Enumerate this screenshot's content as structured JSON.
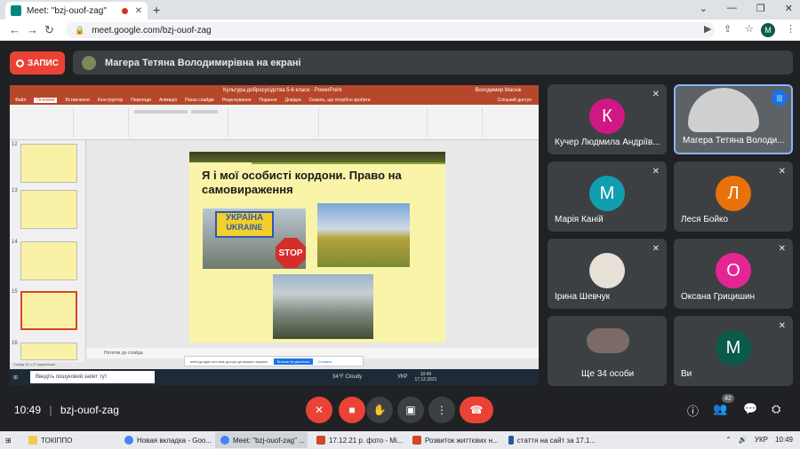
{
  "browser": {
    "tab_title": "Meet: \"bzj-ouof-zag\"",
    "url": "meet.google.com/bzj-ouof-zag",
    "profile_initial": "M"
  },
  "meet": {
    "record_label": "ЗАПИС",
    "presenting_text": "Магера Тетяна Володимирівна на екрані",
    "meeting_code": "bzj-ouof-zag",
    "time": "10:49",
    "participants_count": "42"
  },
  "ppt": {
    "window_title": "Культура добросусідства 5-6 класи - PowerPoint",
    "user": "Володимир Маснік",
    "menu": [
      "Файл",
      "Основне",
      "Вставлення",
      "Конструктор",
      "Переходи",
      "Анімація",
      "Показ слайдів",
      "Рецензування",
      "Подання",
      "Довідка",
      "Скажіть, що потрібно зробити",
      "Спільний доступ"
    ],
    "slide_title": "Я і мої особисті кордони. Право на самовираження",
    "sign_top": "УКРАЇНА",
    "sign_bottom": "UKRAINE",
    "stop": "STOP",
    "notes": "Нотатки до слайда",
    "share_text": "meet.google.com має доступ до вашого екрана.",
    "share_stop": "Більше не ділитися",
    "share_hide": "Сховати",
    "status": "Слайд 15 з 27   українська",
    "win_search": "Введіть пошуковий запит тут",
    "weather": "34°F Cloudy",
    "lang": "УКР",
    "win_time": "10:49",
    "win_date": "17.12.2021",
    "thumb_numbers": [
      "12",
      "13",
      "14",
      "15",
      "16"
    ]
  },
  "tiles": [
    {
      "initial": "К",
      "name": "Кучер Людмила Андріїв...",
      "color": "#d01884"
    },
    {
      "initial": "",
      "name": "Магера Тетяна Володи...",
      "color": "#cfcfcf"
    },
    {
      "initial": "М",
      "name": "Марія Каній",
      "color": "#129eaf"
    },
    {
      "initial": "Л",
      "name": "Леся Бойко",
      "color": "#e8710a"
    },
    {
      "initial": "",
      "name": "Ірина Шевчук",
      "color": "#ddd"
    },
    {
      "initial": "О",
      "name": "Оксана Грицишин",
      "color": "#e52592"
    },
    {
      "initial": "",
      "name": "Ще 34 особи",
      "color": "#555"
    },
    {
      "initial": "М",
      "name": "Ви",
      "color": "#0b5b4a"
    }
  ],
  "taskbar": {
    "items": [
      "ТОКІППО",
      "Новая вкладка - Goo...",
      "Meet: \"bzj-ouof-zag\" ...",
      "17.12.21 р. фото - Mi...",
      "Розвиток життєвих н...",
      "стаття на сайт за 17.1..."
    ],
    "lang": "УКР",
    "time": "10:49"
  }
}
